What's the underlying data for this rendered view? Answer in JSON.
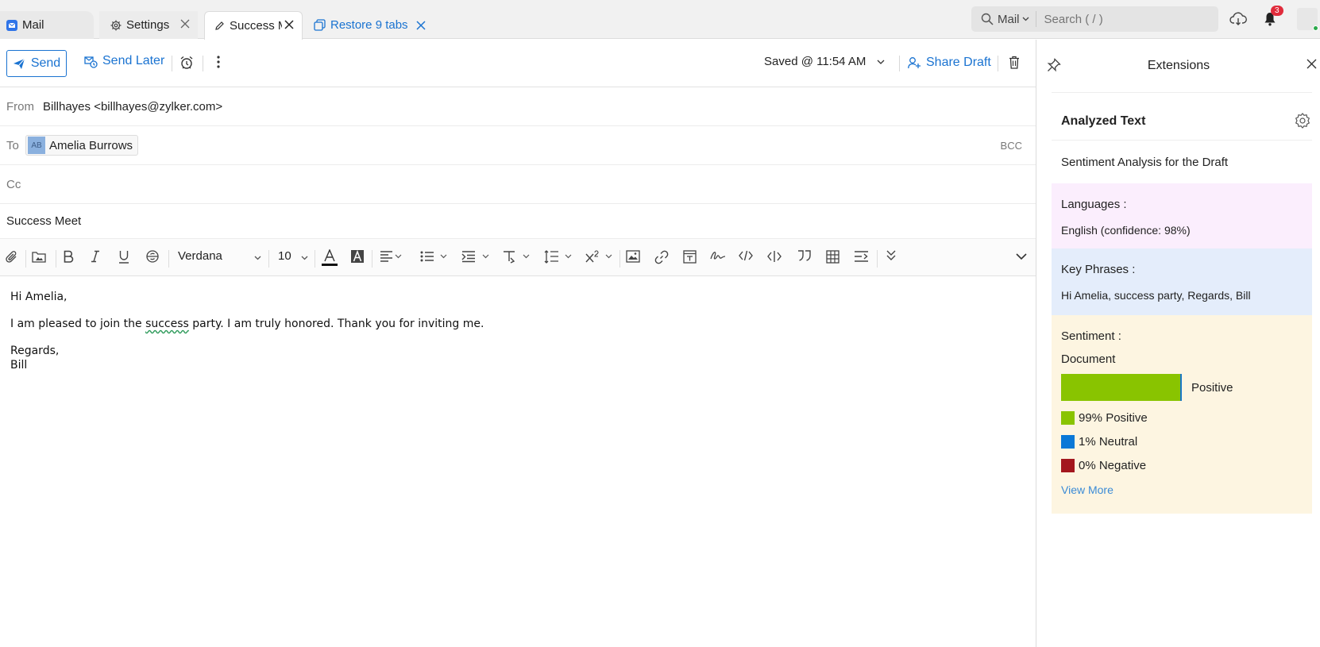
{
  "tabs": {
    "mail": "Mail",
    "settings": "Settings",
    "active": "Success Meet",
    "restore": "Restore 9 tabs"
  },
  "search": {
    "scope": "Mail",
    "placeholder": "Search ( / )"
  },
  "notifications": {
    "count": "3"
  },
  "toolbar": {
    "send": "Send",
    "send_later": "Send Later",
    "saved": "Saved @ 11:54 AM",
    "share_draft": "Share Draft"
  },
  "fields": {
    "from_label": "From",
    "from_value": "Billhayes <billhayes@zylker.com>",
    "to_label": "To",
    "to_initials": "AB",
    "to_name": "Amelia Burrows",
    "bcc": "BCC",
    "cc_label": "Cc",
    "subject": "Success Meet"
  },
  "format": {
    "font": "Verdana",
    "size": "10"
  },
  "body": {
    "greeting": "Hi Amelia,",
    "line_before": "I am pleased to join the ",
    "line_word": "success",
    "line_after": " party. I am truly honored. Thank you for inviting me.",
    "closing": "Regards,",
    "signature": "Bill"
  },
  "extensions": {
    "title": "Extensions",
    "analyzed_text": "Analyzed Text",
    "sentiment_title": "Sentiment Analysis for the Draft",
    "languages_label": "Languages :",
    "languages_value": "English (confidence: 98%)",
    "key_phrases_label": "Key Phrases :",
    "key_phrases_value": "Hi Amelia, success party, Regards, Bill",
    "sentiment_label": "Sentiment :",
    "sentiment_scope": "Document",
    "sentiment_result": "Positive",
    "sentiment_positive_fraction": 0.99,
    "legend": [
      {
        "label": "99% Positive",
        "color": "#89c400"
      },
      {
        "label": "1% Neutral",
        "color": "#0a78d7"
      },
      {
        "label": "0% Negative",
        "color": "#a3171e"
      }
    ],
    "view_more": "View More"
  }
}
